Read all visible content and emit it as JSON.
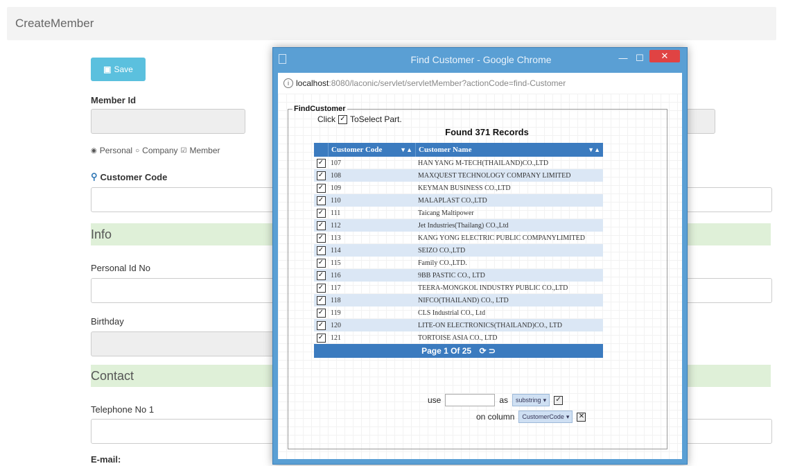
{
  "page": {
    "title": "CreateMember",
    "save_label": "Save",
    "member_id_label": "Member Id",
    "radios": [
      "Personal",
      "Company",
      "Member"
    ],
    "customer_code_label": "Customer Code",
    "info_section": "Info",
    "personal_id_label": "Personal Id No",
    "birthday_label": "Birthday",
    "contact_section": "Contact",
    "telephone_label": "Telephone No 1",
    "email_label": "E-mail:"
  },
  "popup": {
    "window_title": "Find Customer - Google Chrome",
    "url_host": "localhost",
    "url_path": ":8080/laconic/servlet/servletMember?actionCode=find-Customer",
    "fieldset_legend": "FindCustomer",
    "click_text": "Click",
    "to_select_text": "ToSelect Part.",
    "found_text": "Found 371 Records",
    "columns": [
      "Customer Code",
      "Customer Name"
    ],
    "rows": [
      {
        "code": "107",
        "name": "HAN YANG M-TECH(THAILAND)CO.,LTD"
      },
      {
        "code": "108",
        "name": "MAXQUEST TECHNOLOGY COMPANY LIMITED"
      },
      {
        "code": "109",
        "name": "KEYMAN BUSINESS CO.,LTD"
      },
      {
        "code": "110",
        "name": "MALAPLAST CO.,LTD"
      },
      {
        "code": "111",
        "name": "Taicang Maltipower"
      },
      {
        "code": "112",
        "name": "Jet Industries(Thailang) CO.,Ltd"
      },
      {
        "code": "113",
        "name": "KANG YONG ELECTRIC PUBLIC COMPANYLIMITED"
      },
      {
        "code": "114",
        "name": "SEIZO CO.,LTD"
      },
      {
        "code": "115",
        "name": "Family CO.,LTD."
      },
      {
        "code": "116",
        "name": "9BB PASTIC CO., LTD"
      },
      {
        "code": "117",
        "name": "TEERA-MONGKOL INDUSTRY PUBLIC CO.,LTD"
      },
      {
        "code": "118",
        "name": "NIFCO(THAILAND) CO., LTD"
      },
      {
        "code": "119",
        "name": "CLS Industrial CO., Ltd"
      },
      {
        "code": "120",
        "name": "LITE-ON ELECTRONICS(THAILAND)CO., LTD"
      },
      {
        "code": "121",
        "name": "TORTOISE ASIA CO., LTD"
      }
    ],
    "pager": "Page 1  Of 25",
    "use_label": "use",
    "as_label": "as",
    "as_select": "substring",
    "on_column_label": "on column",
    "on_column_select": "CustomerCode"
  },
  "colors": {
    "save_button": "#5bc0de",
    "section_bg": "#dff0d8",
    "popup_frame": "#5a9fd4",
    "grid_header": "#3b7bbf",
    "close_button": "#e04343"
  }
}
